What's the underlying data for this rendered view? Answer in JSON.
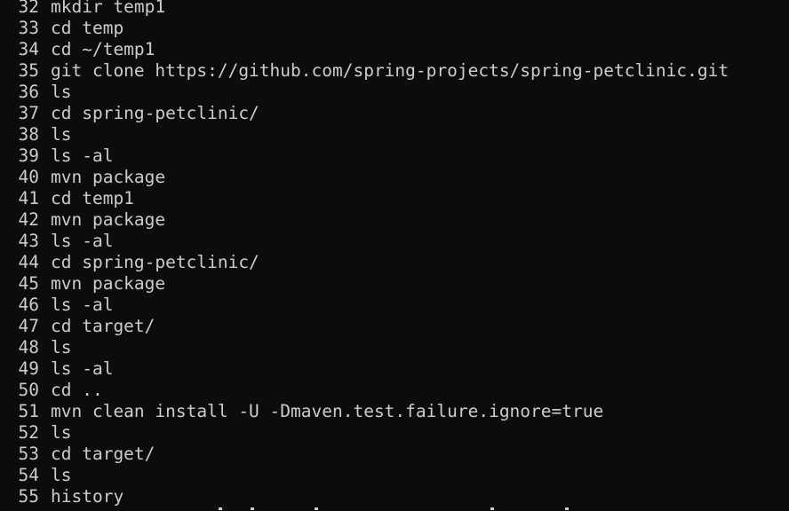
{
  "terminal": {
    "background": "#0c0c0c",
    "foreground": "#cccccc",
    "history": [
      {
        "num": "32",
        "cmd": "mkdir temp1"
      },
      {
        "num": "33",
        "cmd": "cd temp"
      },
      {
        "num": "34",
        "cmd": "cd ~/temp1"
      },
      {
        "num": "35",
        "cmd": "git clone https://github.com/spring-projects/spring-petclinic.git"
      },
      {
        "num": "36",
        "cmd": "ls"
      },
      {
        "num": "37",
        "cmd": "cd spring-petclinic/"
      },
      {
        "num": "38",
        "cmd": "ls"
      },
      {
        "num": "39",
        "cmd": "ls -al"
      },
      {
        "num": "40",
        "cmd": "mvn package"
      },
      {
        "num": "41",
        "cmd": "cd temp1"
      },
      {
        "num": "42",
        "cmd": "mvn package"
      },
      {
        "num": "43",
        "cmd": "ls -al"
      },
      {
        "num": "44",
        "cmd": "cd spring-petclinic/"
      },
      {
        "num": "45",
        "cmd": "mvn package"
      },
      {
        "num": "46",
        "cmd": "ls -al"
      },
      {
        "num": "47",
        "cmd": "cd target/"
      },
      {
        "num": "48",
        "cmd": "ls"
      },
      {
        "num": "49",
        "cmd": "ls -al"
      },
      {
        "num": "50",
        "cmd": "cd .."
      },
      {
        "num": "51",
        "cmd": "mvn clean install -U -Dmaven.test.failure.ignore=true"
      },
      {
        "num": "52",
        "cmd": "ls"
      },
      {
        "num": "53",
        "cmd": "cd target/"
      },
      {
        "num": "54",
        "cmd": "ls"
      },
      {
        "num": "55",
        "cmd": "history"
      }
    ]
  }
}
